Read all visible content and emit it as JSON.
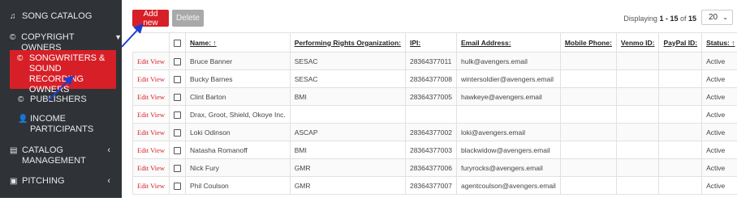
{
  "sidebar": {
    "song_catalog": "SONG CATALOG",
    "copyright_owners": "COPYRIGHT OWNERS",
    "songwriters": "SONGWRITERS & SOUND RECORDING OWNERS",
    "publishers": "PUBLISHERS",
    "income": "INCOME PARTICIPANTS",
    "catalog_mgmt": "CATALOG MANAGEMENT",
    "pitching": "PITCHING"
  },
  "toolbar": {
    "add_label": "Add new",
    "delete_label": "Delete",
    "displaying_prefix": "Displaying ",
    "range": "1 - 15",
    "of_text": " of ",
    "total": "15",
    "page_size": "20"
  },
  "table": {
    "headers": {
      "name": "Name: ↑",
      "pro": "Performing Rights Organization:",
      "ipi": "IPI:",
      "email": "Email Address:",
      "mobile": "Mobile Phone:",
      "venmo": "Venmo ID:",
      "paypal": "PayPal ID:",
      "status": "Status: ↑"
    },
    "action_label": "Edit View",
    "rows": [
      {
        "name": "Bruce Banner",
        "pro": "SESAC",
        "ipi": "28364377011",
        "email": "hulk@avengers.email",
        "status": "Active"
      },
      {
        "name": "Bucky Barnes",
        "pro": "SESAC",
        "ipi": "28364377008",
        "email": "wintersoldier@avengers.email",
        "status": "Active"
      },
      {
        "name": "Clint Barton",
        "pro": "BMI",
        "ipi": "28364377005",
        "email": "hawkeye@avengers.email",
        "status": "Active"
      },
      {
        "name": "Drax, Groot, Shield, Okoye Inc.",
        "pro": "",
        "ipi": "",
        "email": "",
        "status": "Active"
      },
      {
        "name": "Loki Odinson",
        "pro": "ASCAP",
        "ipi": "28364377002",
        "email": "loki@avengers.email",
        "status": "Active"
      },
      {
        "name": "Natasha Romanoff",
        "pro": "BMI",
        "ipi": "28364377003",
        "email": "blackwidow@avengers.email",
        "status": "Active"
      },
      {
        "name": "Nick Fury",
        "pro": "GMR",
        "ipi": "28364377006",
        "email": "furyrocks@avengers.email",
        "status": "Active"
      },
      {
        "name": "Phil Coulson",
        "pro": "GMR",
        "ipi": "28364377007",
        "email": "agentcoulson@avengers.email",
        "status": "Active"
      }
    ]
  },
  "colors": {
    "accent": "#d71f27",
    "sidebar_bg": "#2f3337",
    "annotation_arrow": "#1a3fd1"
  }
}
